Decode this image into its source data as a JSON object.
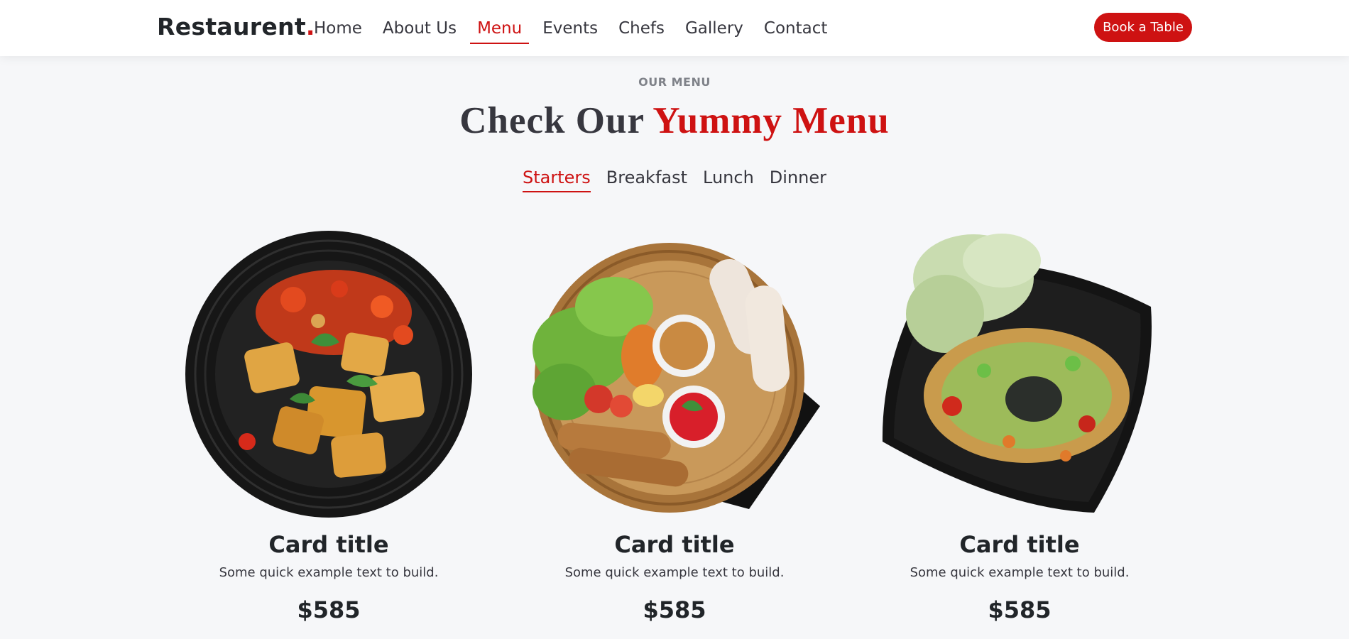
{
  "brand": {
    "name": "Restaurent",
    "dot": "."
  },
  "nav": {
    "links": [
      "Home",
      "About Us",
      "Menu",
      "Events",
      "Chefs",
      "Gallery",
      "Contact"
    ],
    "active_link": "Menu",
    "book_label": "Book a Table"
  },
  "menu_section": {
    "eyebrow": "OUR MENU",
    "title_dark": "Check Our",
    "title_accent": "Yummy Menu",
    "tabs": [
      "Starters",
      "Breakfast",
      "Lunch",
      "Dinner"
    ],
    "active_tab": "Starters"
  },
  "cards": [
    {
      "title": "Card title",
      "text": "Some quick example text to build.",
      "price": "$585",
      "image": "fried-tofu-plate"
    },
    {
      "title": "Card title",
      "text": "Some quick example text to build.",
      "price": "$585",
      "image": "spring-roll-basket"
    },
    {
      "title": "Card title",
      "text": "Some quick example text to build.",
      "price": "$585",
      "image": "papaya-salad-plate"
    }
  ],
  "colors": {
    "accent": "#ce1212",
    "text": "#212529",
    "nav_text": "#37373f",
    "background": "#f6f7f9"
  }
}
